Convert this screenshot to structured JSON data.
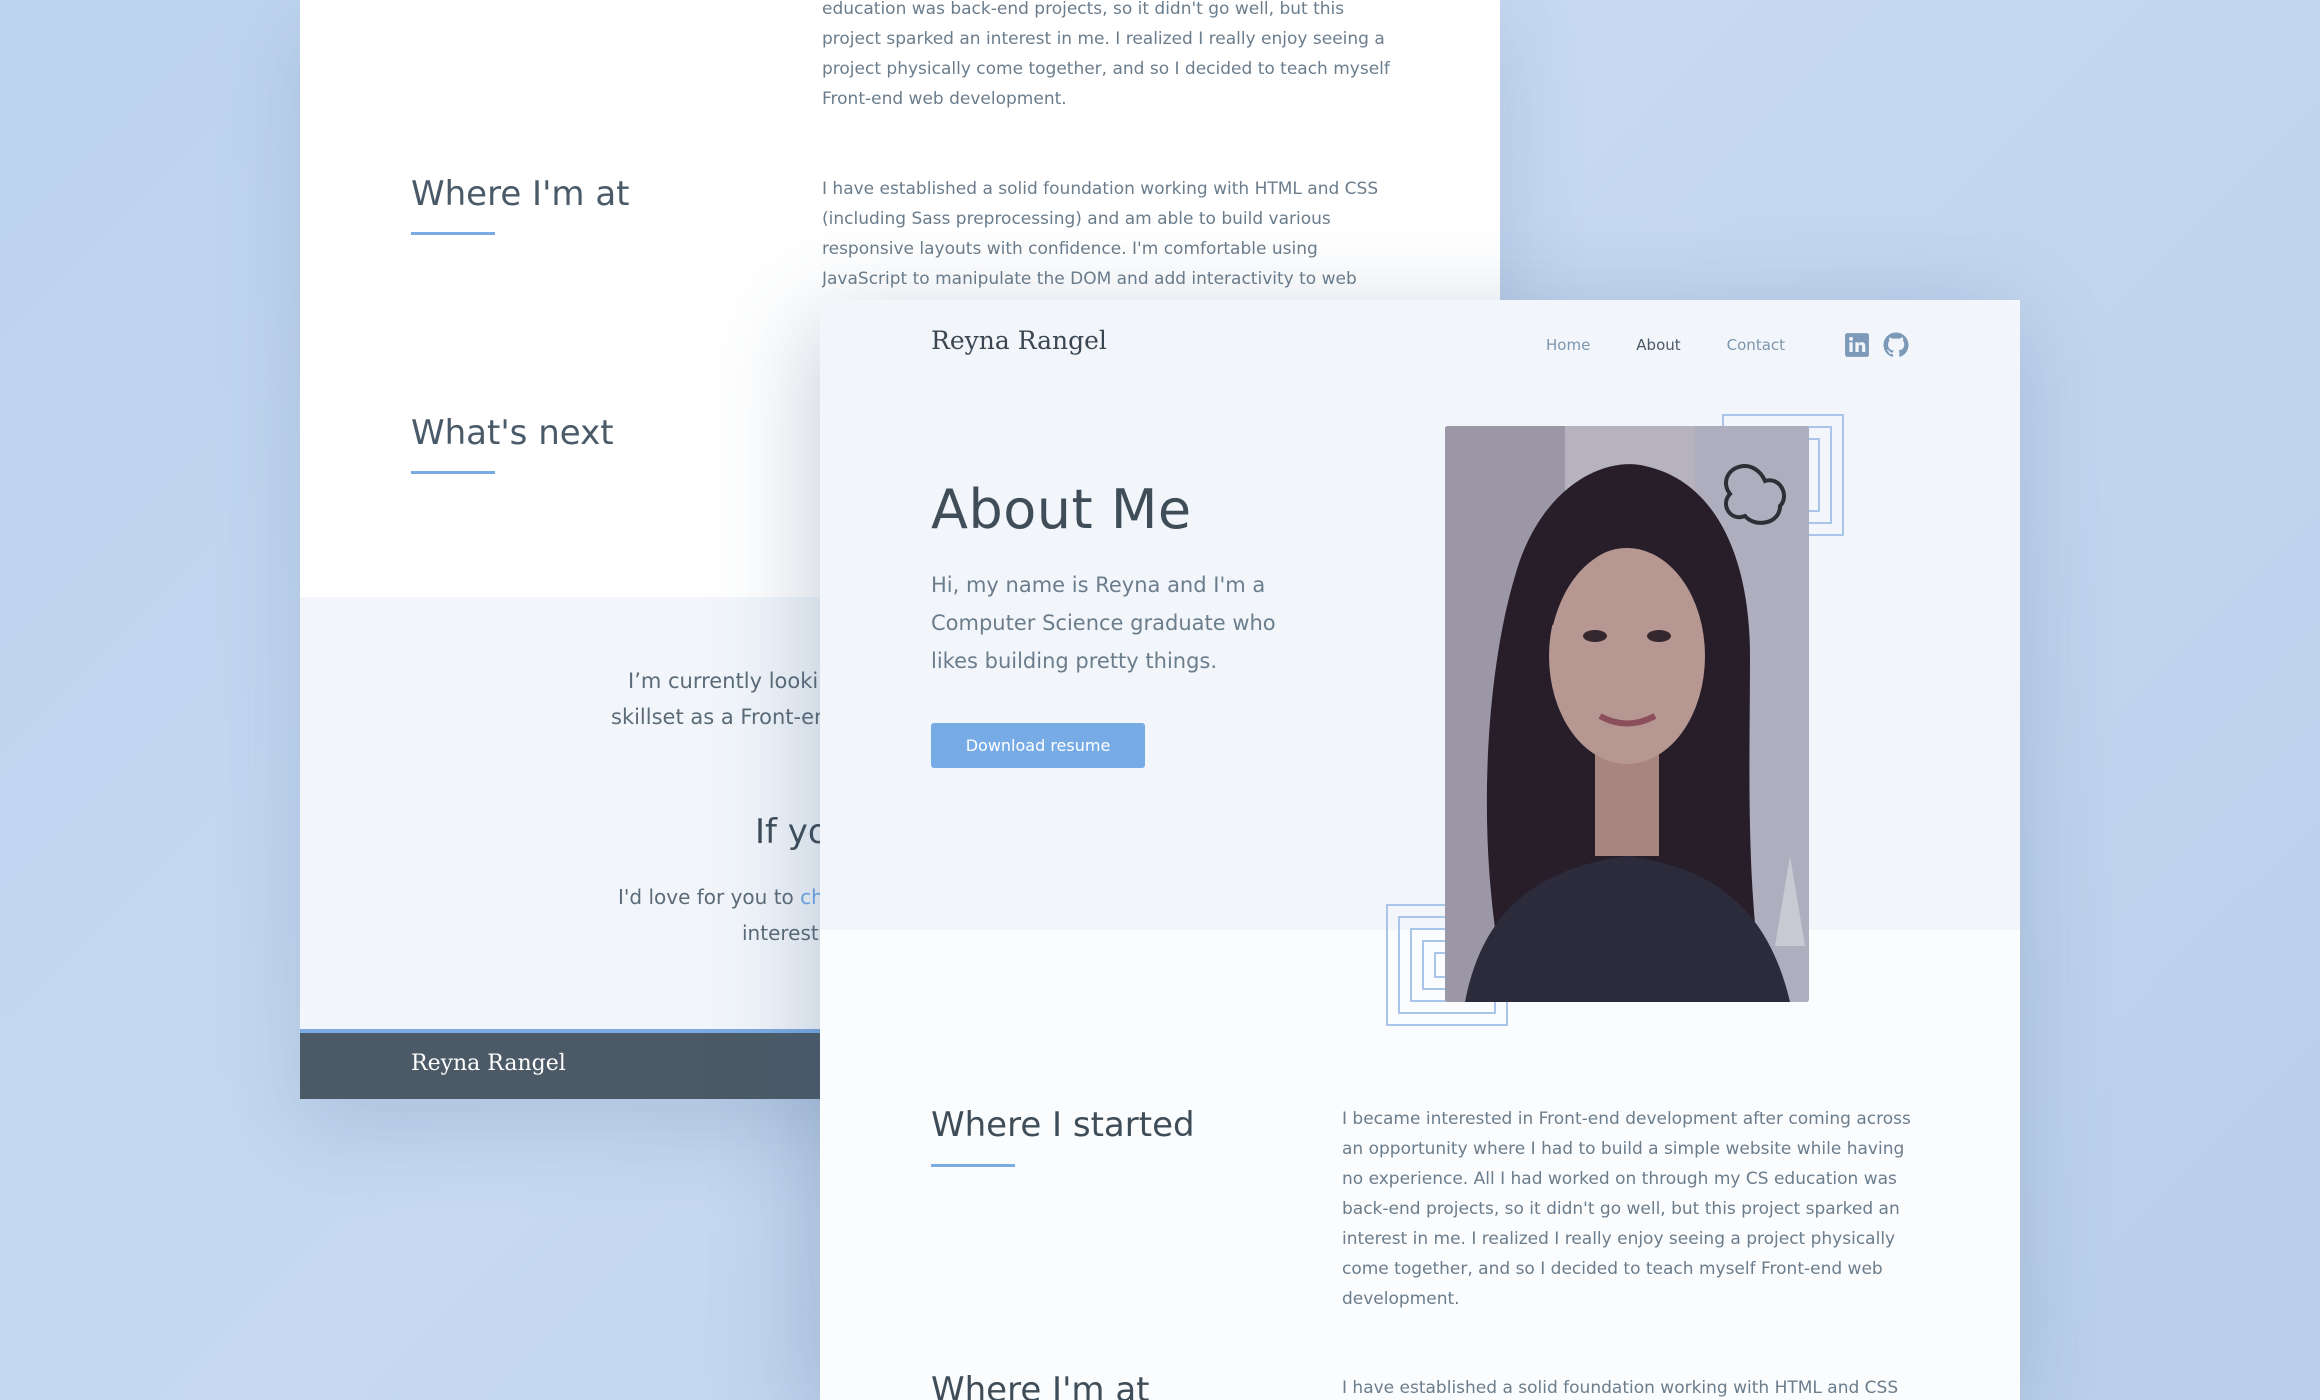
{
  "back_page": {
    "started_paragraph_tail": "education was back-end projects, so it didn't go well, but this project sparked an interest in me. I realized I really enjoy seeing a project physically come together, and so I decided to teach myself Front-end web development.",
    "where_at_heading": "Where I'm at",
    "where_at_paragraph": "I have established a solid foundation working with HTML and CSS (including Sass preprocessing) and am able to build various responsive layouts with confidence. I'm comfortable using JavaScript to manipulate the DOM and add interactivity to web",
    "whats_next_heading": "What's next",
    "band_line1": "I’m currently lookin",
    "band_line2": "skillset as a Front-en",
    "band_heading": "If yo",
    "band_cta_prefix": "I'd love for you to ",
    "band_cta_link": "ch",
    "band_cta_line2": "interest",
    "footer_logo": "Reyna Rangel"
  },
  "front_page": {
    "logo": "Reyna Rangel",
    "nav": {
      "home": "Home",
      "about": "About",
      "contact": "Contact"
    },
    "social_icons": [
      "linkedin-icon",
      "github-icon"
    ],
    "hero": {
      "title": "About Me",
      "intro": "Hi, my name is Reyna and I'm a Computer Science graduate who likes building pretty things.",
      "download_label": "Download resume"
    },
    "started": {
      "heading": "Where I started",
      "paragraph": "I became interested in Front-end development after coming across an opportunity where I had to build a simple website while having no experience. All I had worked on through my CS education was back-end projects, so it didn't go well, but this project sparked an interest in me. I realized I really enjoy seeing a project physically come together, and so I decided to teach myself Front-end web development."
    },
    "where_at": {
      "heading": "Where I'm at",
      "paragraph": "I have established a solid foundation working with HTML and CSS"
    }
  },
  "colors": {
    "accent": "#77abe6",
    "heading": "#3f4d59",
    "body_text": "#6b7d8c",
    "footer": "#4b5a66",
    "background": "#c2d6ef"
  }
}
